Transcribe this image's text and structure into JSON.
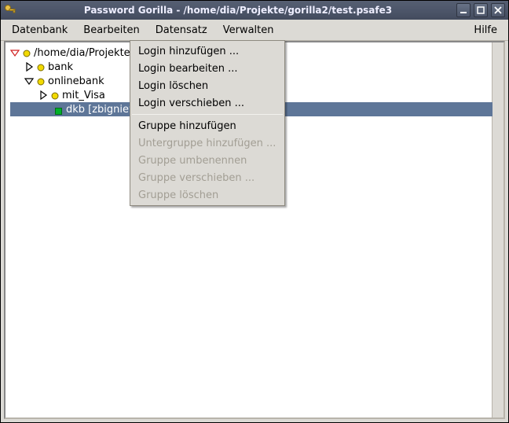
{
  "window": {
    "title": "Password Gorilla - /home/dia/Projekte/gorilla2/test.psafe3"
  },
  "menu": {
    "datenbank": "Datenbank",
    "bearbeiten": "Bearbeiten",
    "datensatz": "Datensatz",
    "verwalten": "Verwalten",
    "hilfe": "Hilfe"
  },
  "tree": {
    "root": "/home/dia/Projekte/g",
    "bank": "bank",
    "onlinebank": "onlinebank",
    "mit_visa": "mit_Visa",
    "dkb": "dkb [zbigniew",
    "colors": {
      "folder_fill": "#f2da00",
      "folder_stroke": "#7a6a00",
      "entry_fill": "#00b028",
      "entry_stroke": "#006b18",
      "open_arrow": "#d02020",
      "closed_arrow": "#000000"
    }
  },
  "context_menu": {
    "login_add": "Login hinzufügen ...",
    "login_edit": "Login bearbeiten ...",
    "login_delete": "Login löschen",
    "login_move": "Login verschieben ...",
    "group_add": "Gruppe hinzufügen",
    "subgroup_add": "Untergruppe hinzufügen ...",
    "group_rename": "Gruppe umbenennen",
    "group_move": "Gruppe verschieben ...",
    "group_delete": "Gruppe löschen"
  }
}
